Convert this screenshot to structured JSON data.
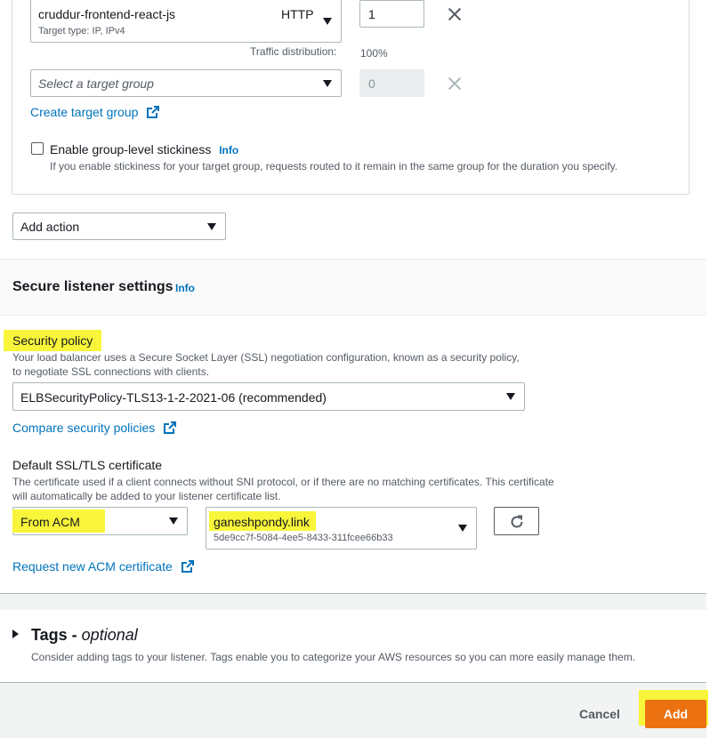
{
  "routing": {
    "target_group_1": {
      "name": "cruddur-frontend-react-js",
      "protocol": "HTTP",
      "subtext": "Target type: IP, IPv4",
      "weight": "1"
    },
    "traffic_distribution_label": "Traffic distribution:",
    "traffic_distribution_value": "100%",
    "target_group_2": {
      "placeholder": "Select a target group",
      "weight": "0"
    },
    "create_target_group_link": "Create target group",
    "stickiness": {
      "label": "Enable group-level stickiness",
      "info": "Info",
      "description": "If you enable stickiness for your target group, requests routed to it remain in the same group for the duration you specify.",
      "checked": false
    },
    "add_action_label": "Add action"
  },
  "secure_listener": {
    "title": "Secure listener settings",
    "info": "Info",
    "security_policy": {
      "label": "Security policy",
      "description_line1": "Your load balancer uses a Secure Socket Layer (SSL) negotiation configuration, known as a security policy,",
      "description_line2": "to negotiate SSL connections with clients.",
      "selected": "ELBSecurityPolicy-TLS13-1-2-2021-06 (recommended)",
      "compare_link": "Compare security policies"
    },
    "certificate": {
      "label": "Default SSL/TLS certificate",
      "description_line1": "The certificate used if a client connects without SNI protocol, or if there are no matching certificates. This certificate",
      "description_line2": "will automatically be added to your listener certificate list.",
      "source": "From ACM",
      "cert_name": "ganeshpondy.link",
      "cert_id": "5de9cc7f-5084-4ee5-8433-311fcee66b33",
      "request_link": "Request new ACM certificate"
    }
  },
  "tags": {
    "title": "Tags - ",
    "title_optional": "optional",
    "description": "Consider adding tags to your listener. Tags enable you to categorize your AWS resources so you can more easily manage them."
  },
  "footer": {
    "cancel_label": "Cancel",
    "add_label": "Add"
  },
  "colors": {
    "highlight": "#f8f53a",
    "primary_button": "#ec7211",
    "link": "#0073bb"
  }
}
